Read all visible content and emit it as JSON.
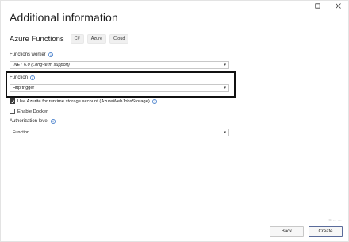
{
  "window": {
    "title": "Additional information",
    "controls": [
      "minimize-icon",
      "maximize-icon",
      "close-icon"
    ]
  },
  "header": {
    "subtitle": "Azure Functions",
    "tags": [
      "C#",
      "Azure",
      "Cloud"
    ]
  },
  "fields": {
    "functions_worker": {
      "label": "Functions worker",
      "value": ".NET 6.0 (Long-term support)"
    },
    "function": {
      "label": "Function",
      "value": "Http trigger"
    },
    "use_azurite": {
      "label": "Use Azurite for runtime storage account (AzureWebJobsStorage)",
      "checked": true
    },
    "enable_docker": {
      "label": "Enable Docker",
      "checked": false
    },
    "authorization_level": {
      "label": "Authorization level",
      "value": "Function"
    }
  },
  "footer": {
    "back_label": "Back",
    "create_label": "Create"
  },
  "watermark": "≳ ⋯ ⋯",
  "colors": {
    "highlight_border": "#111111",
    "primary_button_border": "#5a6b9a"
  }
}
